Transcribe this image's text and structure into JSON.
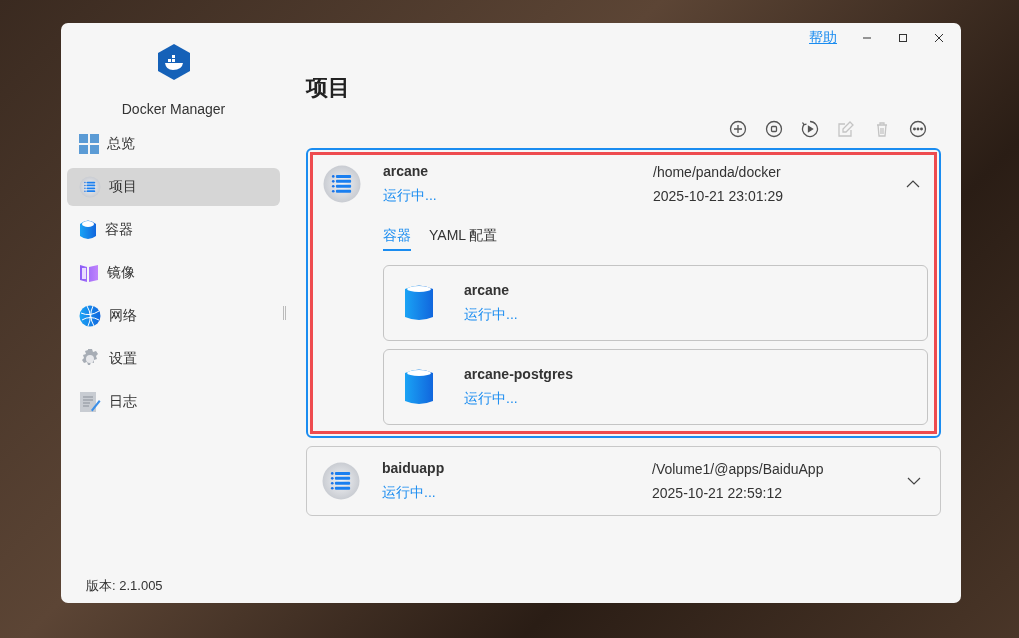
{
  "window": {
    "help_link": "帮助"
  },
  "sidebar": {
    "app_name": "Docker Manager",
    "items": [
      {
        "label": "总览",
        "selected": false
      },
      {
        "label": "项目",
        "selected": true
      },
      {
        "label": "容器",
        "selected": false
      },
      {
        "label": "镜像",
        "selected": false
      },
      {
        "label": "网络",
        "selected": false
      },
      {
        "label": "设置",
        "selected": false
      },
      {
        "label": "日志",
        "selected": false
      }
    ],
    "version": "版本: 2.1.005"
  },
  "page_title": "项目",
  "toolbar": [
    {
      "kind": "add",
      "disabled": false
    },
    {
      "kind": "stop",
      "disabled": false
    },
    {
      "kind": "restart",
      "disabled": false
    },
    {
      "kind": "edit",
      "disabled": true
    },
    {
      "kind": "delete",
      "disabled": true
    },
    {
      "kind": "more",
      "disabled": false
    }
  ],
  "projects": [
    {
      "name": "arcane",
      "status": "运行中...",
      "path": "/home/panda/docker",
      "time": "2025-10-21 23:01:29",
      "selected": true,
      "expanded": true,
      "highlighted": true,
      "tabs": [
        {
          "label": "容器",
          "selected": true
        },
        {
          "label": "YAML 配置",
          "selected": false
        }
      ],
      "containers": [
        {
          "name": "arcane",
          "status": "运行中..."
        },
        {
          "name": "arcane-postgres",
          "status": "运行中..."
        }
      ]
    },
    {
      "name": "baiduapp",
      "status": "运行中...",
      "path": "/Volume1/@apps/BaiduApp",
      "time": "2025-10-21 22:59:12",
      "selected": false,
      "expanded": false,
      "highlighted": false
    }
  ]
}
